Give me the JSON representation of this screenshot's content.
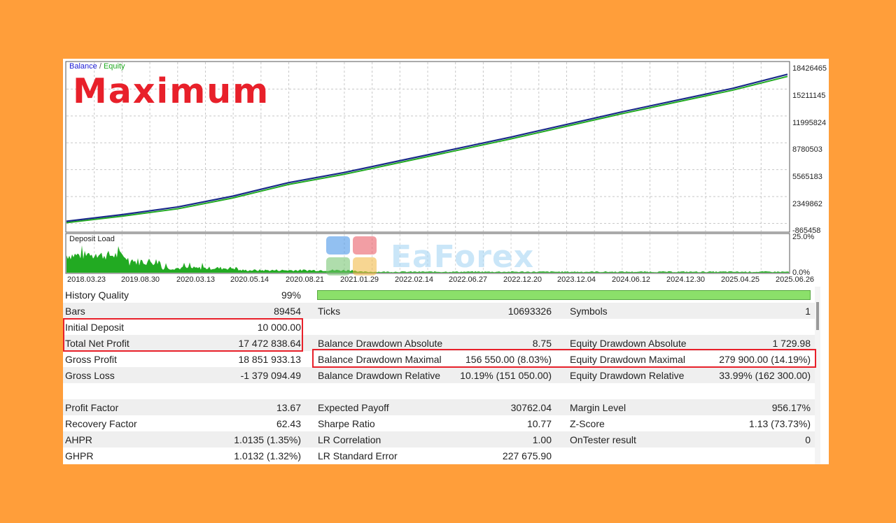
{
  "chart": {
    "legend": {
      "balance": "Balance",
      "sep": " / ",
      "equity": "Equity"
    },
    "overlay_title": "Maximum",
    "y_labels": [
      "18426465",
      "15211145",
      "11995824",
      "8780503",
      "5565183",
      "2349862",
      "-865458"
    ],
    "deposit_title": "Deposit Load",
    "deposit_y_labels": [
      "25.0%",
      "0.0%"
    ],
    "dates": [
      "2018.03.23",
      "2019.08.30",
      "2020.03.13",
      "2020.05.14",
      "2020.08.21",
      "2021.01.29",
      "2022.02.14",
      "2022.06.27",
      "2022.12.20",
      "2023.12.04",
      "2024.06.12",
      "2024.12.30",
      "2025.04.25",
      "2025.06.26"
    ],
    "colors": {
      "balance": "#1a2a8a",
      "equity": "#22aa22",
      "deposit": "#22aa22",
      "highlight": "#E8202A"
    },
    "watermark": "EaForex",
    "watermark_icon": "eaforex-logo-icon"
  },
  "chart_data": {
    "type": "line",
    "x": [
      "2018.03.23",
      "2019.08.30",
      "2020.03.13",
      "2020.05.14",
      "2020.08.21",
      "2021.01.29",
      "2022.02.14",
      "2022.06.27",
      "2022.12.20",
      "2023.12.04",
      "2024.06.12",
      "2024.12.30",
      "2025.04.25",
      "2025.06.26"
    ],
    "series": [
      {
        "name": "Balance",
        "values": [
          10000,
          800000,
          1700000,
          3000000,
          4600000,
          5800000,
          7200000,
          8600000,
          10000000,
          11500000,
          13000000,
          14400000,
          15800000,
          17482838
        ]
      },
      {
        "name": "Equity",
        "values": [
          10000,
          780000,
          1650000,
          2950000,
          4550000,
          5750000,
          7150000,
          8550000,
          9950000,
          11450000,
          12950000,
          14350000,
          15750000,
          17400000
        ]
      }
    ],
    "ylim": [
      -865458,
      18426465
    ]
  },
  "stats": {
    "history_quality": {
      "label": "History Quality",
      "value": "99%"
    },
    "bars": {
      "label": "Bars",
      "value": "89454"
    },
    "ticks": {
      "label": "Ticks",
      "value": "10693326"
    },
    "symbols": {
      "label": "Symbols",
      "value": "1"
    },
    "initial_deposit": {
      "label": "Initial Deposit",
      "value": "10 000.00"
    },
    "total_net_profit": {
      "label": "Total Net Profit",
      "value": "17 472 838.64"
    },
    "balance_dd_abs": {
      "label": "Balance Drawdown Absolute",
      "value": "8.75"
    },
    "equity_dd_abs": {
      "label": "Equity Drawdown Absolute",
      "value": "1 729.98"
    },
    "gross_profit": {
      "label": "Gross Profit",
      "value": "18 851 933.13"
    },
    "balance_dd_max": {
      "label": "Balance Drawdown Maximal",
      "value": "156 550.00 (8.03%)"
    },
    "equity_dd_max": {
      "label": "Equity Drawdown Maximal",
      "value": "279 900.00 (14.19%)"
    },
    "gross_loss": {
      "label": "Gross Loss",
      "value": "-1 379 094.49"
    },
    "balance_dd_rel": {
      "label": "Balance Drawdown Relative",
      "value": "10.19% (151 050.00)"
    },
    "equity_dd_rel": {
      "label": "Equity Drawdown Relative",
      "value": "33.99% (162 300.00)"
    },
    "profit_factor": {
      "label": "Profit Factor",
      "value": "13.67"
    },
    "expected_payoff": {
      "label": "Expected Payoff",
      "value": "30762.04"
    },
    "margin_level": {
      "label": "Margin Level",
      "value": "956.17%"
    },
    "recovery_factor": {
      "label": "Recovery Factor",
      "value": "62.43"
    },
    "sharpe_ratio": {
      "label": "Sharpe Ratio",
      "value": "10.77"
    },
    "z_score": {
      "label": "Z-Score",
      "value": "1.13 (73.73%)"
    },
    "ahpr": {
      "label": "AHPR",
      "value": "1.0135 (1.35%)"
    },
    "lr_correlation": {
      "label": "LR Correlation",
      "value": "1.00"
    },
    "ontester": {
      "label": "OnTester result",
      "value": "0"
    },
    "ghpr": {
      "label": "GHPR",
      "value": "1.0132 (1.32%)"
    },
    "lr_std_error": {
      "label": "LR Standard Error",
      "value": "227 675.90"
    }
  }
}
